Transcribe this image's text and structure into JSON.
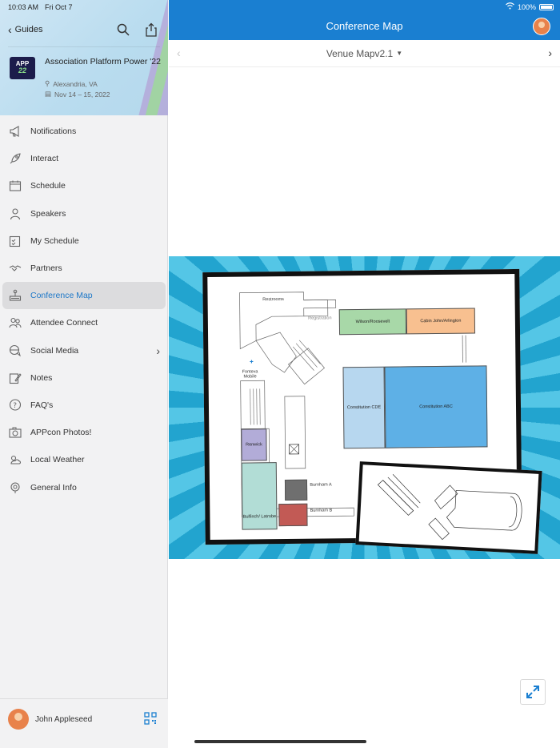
{
  "status_bar": {
    "time": "10:03 AM",
    "date": "Fri Oct 7",
    "battery": "100%"
  },
  "sidebar": {
    "back_label": "Guides",
    "logo": {
      "top": "APP",
      "bottom": "22"
    },
    "event": {
      "title": "Association Platform Power '22",
      "location": "Alexandria, VA",
      "dates": "Nov 14 – 15, 2022"
    },
    "items": [
      {
        "label": "Notifications",
        "icon": "megaphone-icon"
      },
      {
        "label": "Interact",
        "icon": "rocket-icon"
      },
      {
        "label": "Schedule",
        "icon": "calendar-icon"
      },
      {
        "label": "Speakers",
        "icon": "person-icon"
      },
      {
        "label": "My Schedule",
        "icon": "checklist-calendar-icon"
      },
      {
        "label": "Partners",
        "icon": "handshake-icon"
      },
      {
        "label": "Conference Map",
        "icon": "map-icon",
        "active": true
      },
      {
        "label": "Attendee Connect",
        "icon": "people-icon"
      },
      {
        "label": "Social Media",
        "icon": "chat-globe-icon",
        "has_arrow": true
      },
      {
        "label": "Notes",
        "icon": "pencil-note-icon"
      },
      {
        "label": "FAQ's",
        "icon": "faq-icon"
      },
      {
        "label": "APPcon Photos!",
        "icon": "camera-icon"
      },
      {
        "label": "Local Weather",
        "icon": "weather-icon"
      },
      {
        "label": "General Info",
        "icon": "info-icon"
      }
    ],
    "user": {
      "name": "John Appleseed"
    }
  },
  "main": {
    "title": "Conference Map",
    "selector": "Venue Mapv2.1",
    "map": {
      "labels": {
        "restrooms": "Restrooms",
        "registration": "Registration",
        "wilson": "Wilson/Roosevelt",
        "cabin": "Cabin John/Arlington",
        "fonteva": "Fonteva Mobile",
        "constitution_cde": "Constitution CDE",
        "constitution_abc": "Constitution ABC",
        "renwick": "Renwick",
        "burnham_a": "Burnham A",
        "burnham_b": "Burnham B",
        "bulfinch": "Bulfinch/ Latrobe"
      },
      "colors": {
        "wilson": "#a8d8a8",
        "cabin": "#f8c090",
        "constitution_cde": "#b7d7ef",
        "constitution_abc": "#5eb0e6",
        "renwick": "#b2acd8",
        "bulfinch": "#b2ddd6",
        "burnham_a": "#6f6f6f",
        "burnham_b": "#c25a55"
      }
    }
  },
  "accent": "#1a7fd1"
}
